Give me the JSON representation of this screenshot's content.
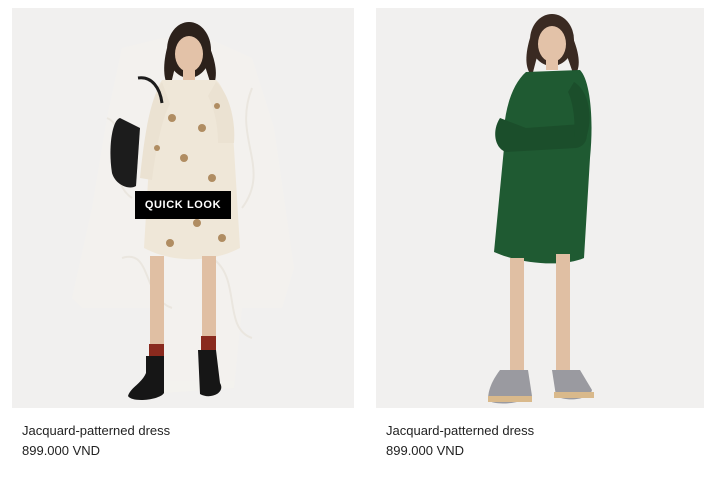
{
  "products": [
    {
      "name": "Jacquard-patterned dress",
      "price": "899.000 VND",
      "quick_look_label": "QUICK LOOK",
      "image_subject": "cream monkey-print shirt dress with black backpack"
    },
    {
      "name": "Jacquard-patterned dress",
      "price": "899.000 VND",
      "image_subject": "dark green shirt dress with silver platform shoes"
    }
  ],
  "colors": {
    "image_bg": "#f1f0ef",
    "text": "#222222",
    "quick_look_bg": "#000000",
    "quick_look_text": "#ffffff",
    "dress_cream": "#efe7d8",
    "dress_green": "#1f5a32"
  }
}
